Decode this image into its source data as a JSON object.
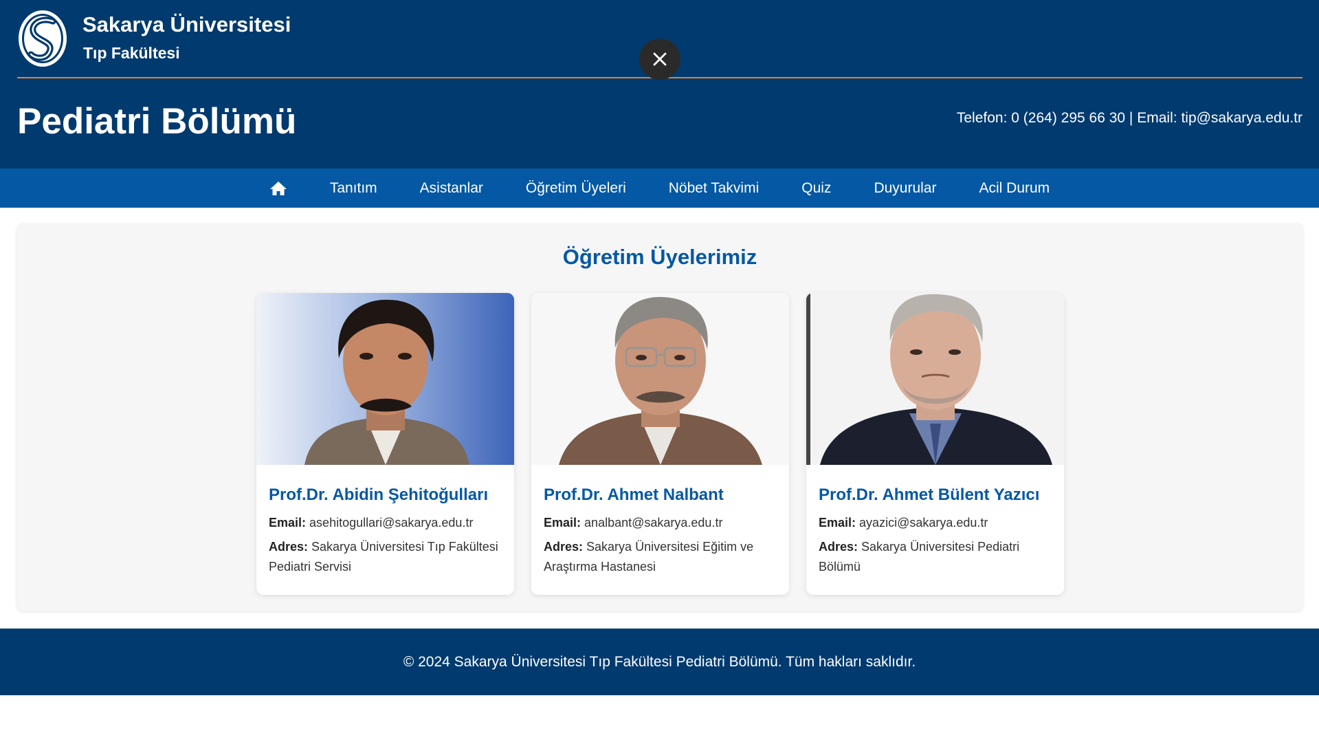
{
  "header": {
    "university": "Sakarya Üniversitesi",
    "faculty": "Tıp Fakültesi",
    "department": "Pediatri Bölümü",
    "phone_label": "Telefon:",
    "phone": "0 (264) 295 66 30",
    "separator": "|",
    "email_label": "Email:",
    "email": "tip@sakarya.edu.tr",
    "logo_icon": "sakarya-logo-icon",
    "close_icon": "close-icon"
  },
  "nav": {
    "home_icon": "home-icon",
    "items": [
      "Tanıtım",
      "Asistanlar",
      "Öğretim Üyeleri",
      "Nöbet Takvimi",
      "Quiz",
      "Duyurular",
      "Acil Durum"
    ]
  },
  "main": {
    "title": "Öğretim Üyelerimiz",
    "email_label": "Email:",
    "address_label": "Adres:",
    "members": [
      {
        "name": "Prof.Dr. Abidin Şehitoğulları",
        "email": "asehitogullari@sakarya.edu.tr",
        "address": "Sakarya Üniversitesi Tıp Fakültesi Pediatri Servisi"
      },
      {
        "name": "Prof.Dr. Ahmet Nalbant",
        "email": "analbant@sakarya.edu.tr",
        "address": "Sakarya Üniversitesi Eğitim ve Araştırma Hastanesi"
      },
      {
        "name": "Prof.Dr. Ahmet Bülent Yazıcı",
        "email": "ayazici@sakarya.edu.tr",
        "address": "Sakarya Üniversitesi Pediatri Bölümü"
      }
    ]
  },
  "footer": {
    "text": "© 2024 Sakarya Üniversitesi Tıp Fakültesi Pediatri Bölümü. Tüm hakları saklıdır."
  },
  "colors": {
    "header_bg": "#003a6e",
    "nav_bg": "#0458a4",
    "accent_line": "#e8812a",
    "title_blue": "#0458a4"
  }
}
